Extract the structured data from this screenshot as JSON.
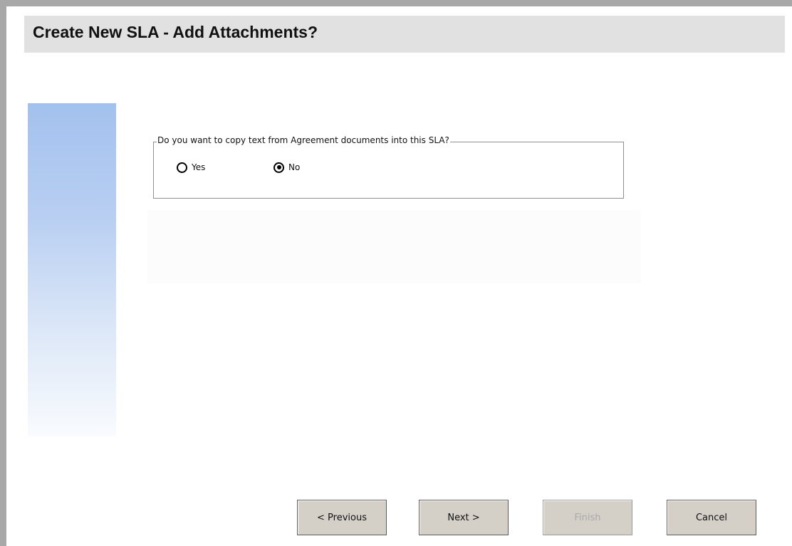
{
  "header": {
    "title": "Create New SLA - Add Attachments?"
  },
  "question": {
    "legend": "Do you want to copy text from Agreement documents into this SLA?",
    "options": [
      {
        "label": "Yes",
        "selected": false
      },
      {
        "label": "No",
        "selected": true
      }
    ]
  },
  "buttons": {
    "previous": "< Previous",
    "next": "Next >",
    "finish": "Finish",
    "finish_enabled": false,
    "cancel": "Cancel"
  },
  "colors": {
    "title_bar": "#e1e1e1",
    "side_panel_top": "#a3c1ee",
    "button_face": "#d4d0c8",
    "window_border": "#a8a8a8"
  }
}
